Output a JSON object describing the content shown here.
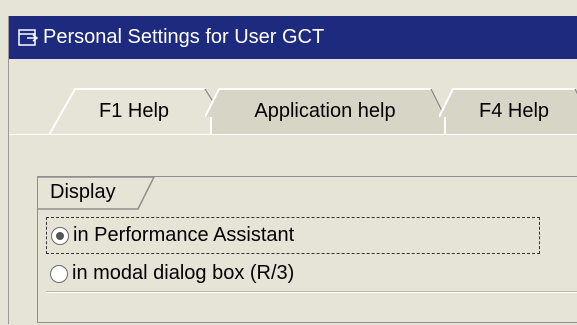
{
  "window": {
    "title": "Personal Settings for User GCT"
  },
  "tabs": [
    {
      "label": "F1 Help",
      "active": true
    },
    {
      "label": "Application help",
      "active": false
    },
    {
      "label": "F4 Help",
      "active": false
    }
  ],
  "display_group": {
    "label": "Display",
    "options": [
      {
        "label": "in Performance Assistant",
        "checked": true
      },
      {
        "label": "in modal dialog box (R/3)",
        "checked": false
      }
    ]
  },
  "colors": {
    "titlebar": "#1d2a7e",
    "background": "#e6e4d6"
  }
}
